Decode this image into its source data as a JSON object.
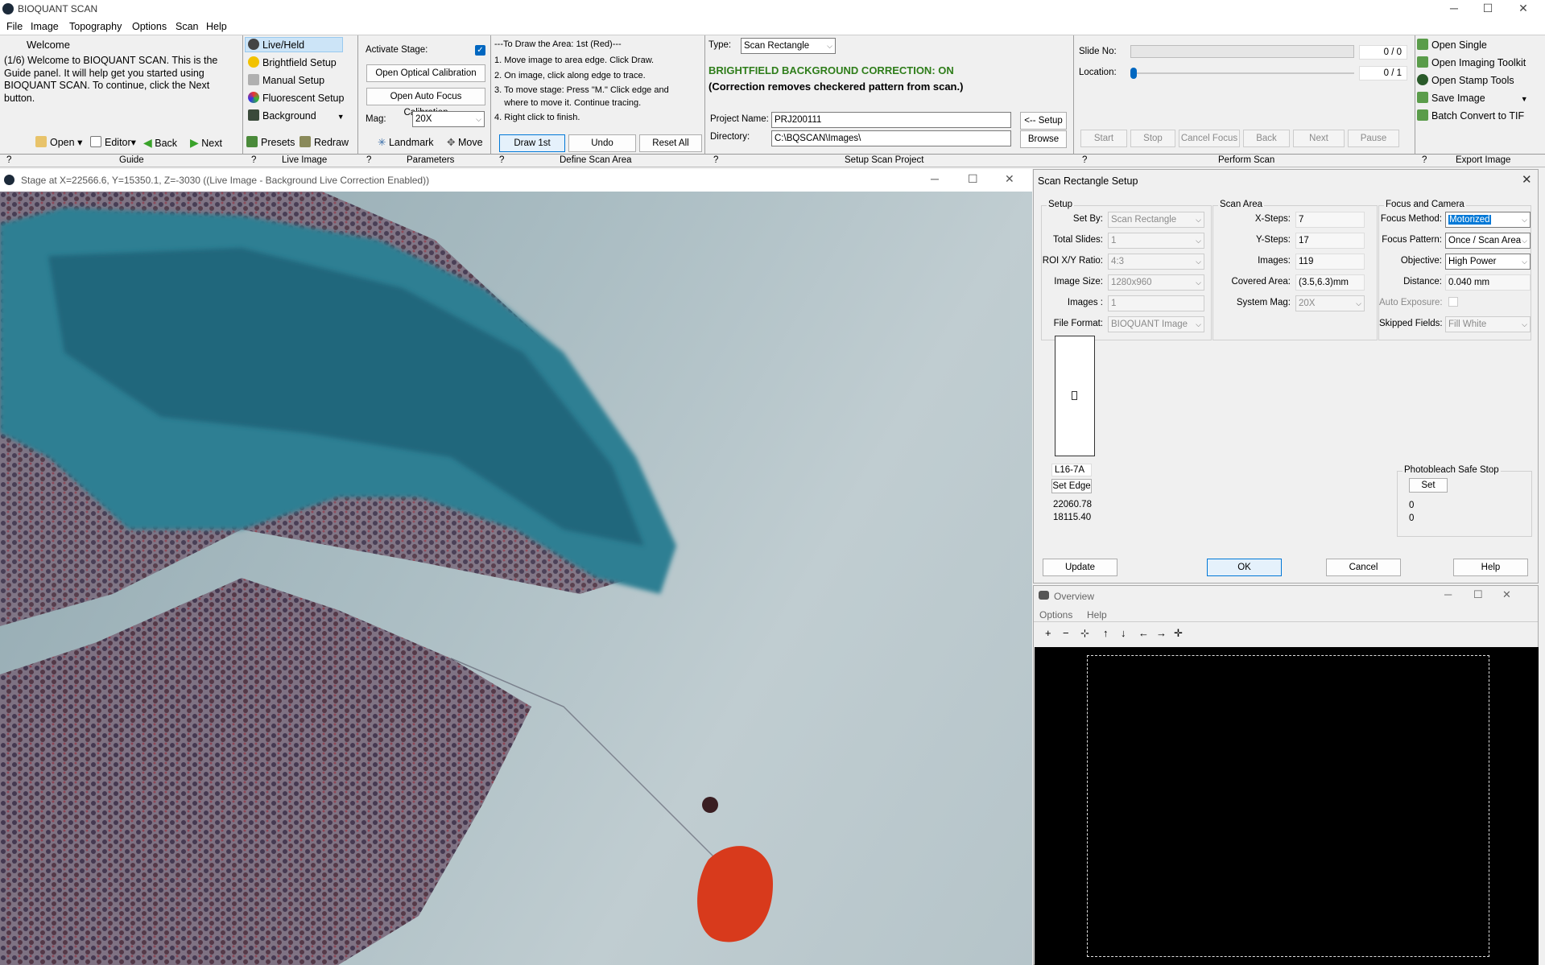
{
  "app": {
    "title": "BIOQUANT SCAN",
    "win_min": "─",
    "win_max": "☐",
    "win_close": "✕"
  },
  "menu": [
    "File",
    "Image",
    "Topography",
    "Options",
    "Scan",
    "Help"
  ],
  "guide": {
    "heading": "Welcome",
    "text": "(1/6) Welcome to BIOQUANT SCAN. This is the Guide panel. It will help get you started using BIOQUANT SCAN. To continue, click the Next button.",
    "open": "Open",
    "editor": "Editor",
    "back": "Back",
    "next": "Next"
  },
  "live_image": {
    "items": [
      "Live/Held",
      "Brightfield Setup",
      "Manual Setup",
      "Fluorescent Setup",
      "Background"
    ],
    "presets": "Presets",
    "redraw": "Redraw"
  },
  "parameters": {
    "activate_stage": "Activate Stage:",
    "activate_checked": true,
    "open_optical": "Open Optical Calibration",
    "open_autofocus": "Open Auto Focus Calibration",
    "mag_label": "Mag:",
    "mag_value": "20X",
    "landmark": "Landmark",
    "move": "Move"
  },
  "define_area": {
    "lines": [
      "---To Draw the Area: 1st (Red)---",
      "1. Move image to area edge. Click Draw.",
      "2. On image, click along edge to trace.",
      "3. To move stage: Press \"M.\" Click edge and",
      "    where to move it. Continue tracing.",
      "4. Right click to finish."
    ],
    "draw": "Draw 1st",
    "undo": "Undo",
    "reset": "Reset All"
  },
  "setup_project": {
    "type_label": "Type:",
    "type_value": "Scan Rectangle",
    "status1": "BRIGHTFIELD BACKGROUND CORRECTION: ON",
    "status2": "(Correction removes checkered pattern from scan.)",
    "project_label": "Project Name:",
    "project_value": "PRJ200111",
    "setup_btn": "<-- Setup",
    "dir_label": "Directory:",
    "dir_value": "C:\\BQSCAN\\Images\\",
    "browse": "Browse",
    "status_color": "#2e7d1a"
  },
  "perform_scan": {
    "slide_label": "Slide No:",
    "slide_value": "0 / 0",
    "location_label": "Location:",
    "location_value": "0 / 1",
    "buttons": [
      "Start",
      "Stop",
      "Cancel Focus",
      "Back",
      "Next",
      "Pause"
    ]
  },
  "export": {
    "items": [
      "Open Single",
      "Open Imaging Toolkit",
      "Open Stamp Tools",
      "Save Image",
      "Batch Convert to TIF"
    ]
  },
  "sections": [
    "?",
    "Guide",
    "?",
    "Live Image",
    "?",
    "Parameters",
    "?",
    "Define Scan Area",
    "?",
    "Setup Scan Project",
    "?",
    "Perform Scan",
    "?",
    "Export Image"
  ],
  "live_window": {
    "title": "Stage at X=22566.6, Y=15350.1, Z=-3030  ((Live Image - Background Live Correction Enabled))"
  },
  "dialog": {
    "title": "Scan Rectangle Setup",
    "setup": {
      "title": "Setup",
      "set_by_label": "Set By:",
      "set_by": "Scan Rectangle",
      "total_slides_label": "Total Slides:",
      "total_slides": "1",
      "roi_label": "ROI X/Y Ratio:",
      "roi": "4:3",
      "image_size_label": "Image Size:",
      "image_size": "1280x960",
      "images_label": "Images :",
      "images": "1",
      "file_format_label": "File Format:",
      "file_format": "BIOQUANT Image"
    },
    "scan_area": {
      "title": "Scan Area",
      "x_steps_label": "X-Steps:",
      "x_steps": "7",
      "y_steps_label": "Y-Steps:",
      "y_steps": "17",
      "images_label": "Images:",
      "images": "119",
      "covered_label": "Covered Area:",
      "covered": "(3.5,6.3)mm",
      "mag_label": "System Mag:",
      "mag": "20X"
    },
    "focus": {
      "title": "Focus and Camera",
      "method_label": "Focus Method:",
      "method": "Motorized",
      "pattern_label": "Focus Pattern:",
      "pattern": "Once / Scan Area",
      "objective_label": "Objective:",
      "objective": "High Power",
      "distance_label": "Distance:",
      "distance": "0.040 mm",
      "auto_exposure_label": "Auto Exposure:",
      "skipped_label": "Skipped Fields:",
      "skipped": "Fill White"
    },
    "slide_label": "L16-7A",
    "set_edge": "Set Edge",
    "coord_x": "22060.78",
    "coord_y": "18115.40",
    "photobleach": {
      "title": "Photobleach Safe Stop",
      "set": "Set",
      "v1": "0",
      "v2": "0"
    },
    "buttons": {
      "update": "Update",
      "ok": "OK",
      "cancel": "Cancel",
      "help": "Help"
    }
  },
  "overview": {
    "title": "Overview",
    "menu": [
      "Options",
      "Help"
    ],
    "tools": [
      "+",
      "−",
      "⊹",
      "↑",
      "↓",
      "←",
      "→",
      "✛"
    ]
  }
}
